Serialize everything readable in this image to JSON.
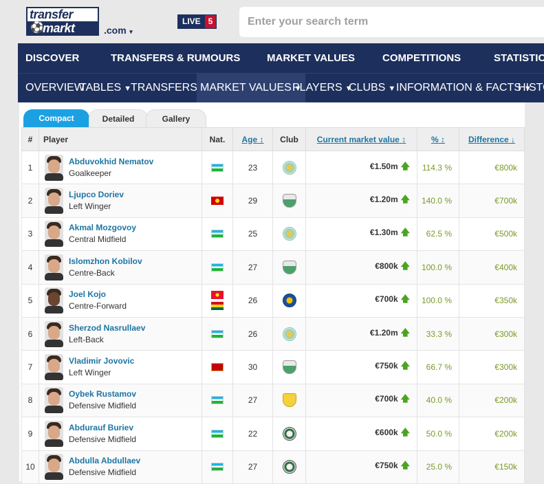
{
  "header": {
    "logo_line1": "transfer",
    "logo_line2": "markt",
    "domain": ".com",
    "live_label": "LIVE",
    "live_count": "5",
    "search_placeholder": "Enter your search term"
  },
  "main_nav": [
    "DISCOVER",
    "TRANSFERS & RUMOURS",
    "MARKET VALUES",
    "COMPETITIONS",
    "STATISTICS"
  ],
  "sub_nav": [
    {
      "label": "OVERVIEW",
      "dropdown": false
    },
    {
      "label": "TABLES",
      "dropdown": true
    },
    {
      "label": "TRANSFERS",
      "dropdown": true
    },
    {
      "label": "MARKET VALUES",
      "dropdown": true,
      "active": true
    },
    {
      "label": "PLAYERS",
      "dropdown": true
    },
    {
      "label": "CLUBS",
      "dropdown": true
    },
    {
      "label": "INFORMATION & FACTS",
      "dropdown": true
    },
    {
      "label": "HISTO",
      "dropdown": false
    }
  ],
  "view_tabs": [
    "Compact",
    "Detailed",
    "Gallery"
  ],
  "table": {
    "headers": {
      "num": "#",
      "player": "Player",
      "nat": "Nat.",
      "age": "Age",
      "club": "Club",
      "value": "Current market value",
      "pct": "%",
      "diff": "Difference"
    },
    "rows": [
      {
        "num": "1",
        "name": "Abduvokhid Nematov",
        "position": "Goalkeeper",
        "age": "23",
        "value": "€1.50m",
        "pct": "114.3 %",
        "diff": "€800k"
      },
      {
        "num": "2",
        "name": "Ljupco Doriev",
        "position": "Left Winger",
        "age": "29",
        "value": "€1.20m",
        "pct": "140.0 %",
        "diff": "€700k"
      },
      {
        "num": "3",
        "name": "Akmal Mozgovoy",
        "position": "Central Midfield",
        "age": "25",
        "value": "€1.30m",
        "pct": "62.5 %",
        "diff": "€500k"
      },
      {
        "num": "4",
        "name": "Islomzhon Kobilov",
        "position": "Centre-Back",
        "age": "27",
        "value": "€800k",
        "pct": "100.0 %",
        "diff": "€400k"
      },
      {
        "num": "5",
        "name": "Joel Kojo",
        "position": "Centre-Forward",
        "age": "26",
        "value": "€700k",
        "pct": "100.0 %",
        "diff": "€350k"
      },
      {
        "num": "6",
        "name": "Sherzod Nasrullaev",
        "position": "Left-Back",
        "age": "26",
        "value": "€1.20m",
        "pct": "33.3 %",
        "diff": "€300k"
      },
      {
        "num": "7",
        "name": "Vladimir Jovovic",
        "position": "Left Winger",
        "age": "30",
        "value": "€750k",
        "pct": "66.7 %",
        "diff": "€300k"
      },
      {
        "num": "8",
        "name": "Oybek Rustamov",
        "position": "Defensive Midfield",
        "age": "27",
        "value": "€700k",
        "pct": "40.0 %",
        "diff": "€200k"
      },
      {
        "num": "9",
        "name": "Abdurauf Buriev",
        "position": "Defensive Midfield",
        "age": "22",
        "value": "€600k",
        "pct": "50.0 %",
        "diff": "€200k"
      },
      {
        "num": "10",
        "name": "Abdulla Abdullaev",
        "position": "Defensive Midfield",
        "age": "27",
        "value": "€750k",
        "pct": "25.0 %",
        "diff": "€150k"
      }
    ]
  },
  "colors": {
    "brand_navy": "#1d2f5c",
    "accent_blue": "#1ba1e2",
    "link": "#1d75a3",
    "up_green": "#4ca41f"
  }
}
